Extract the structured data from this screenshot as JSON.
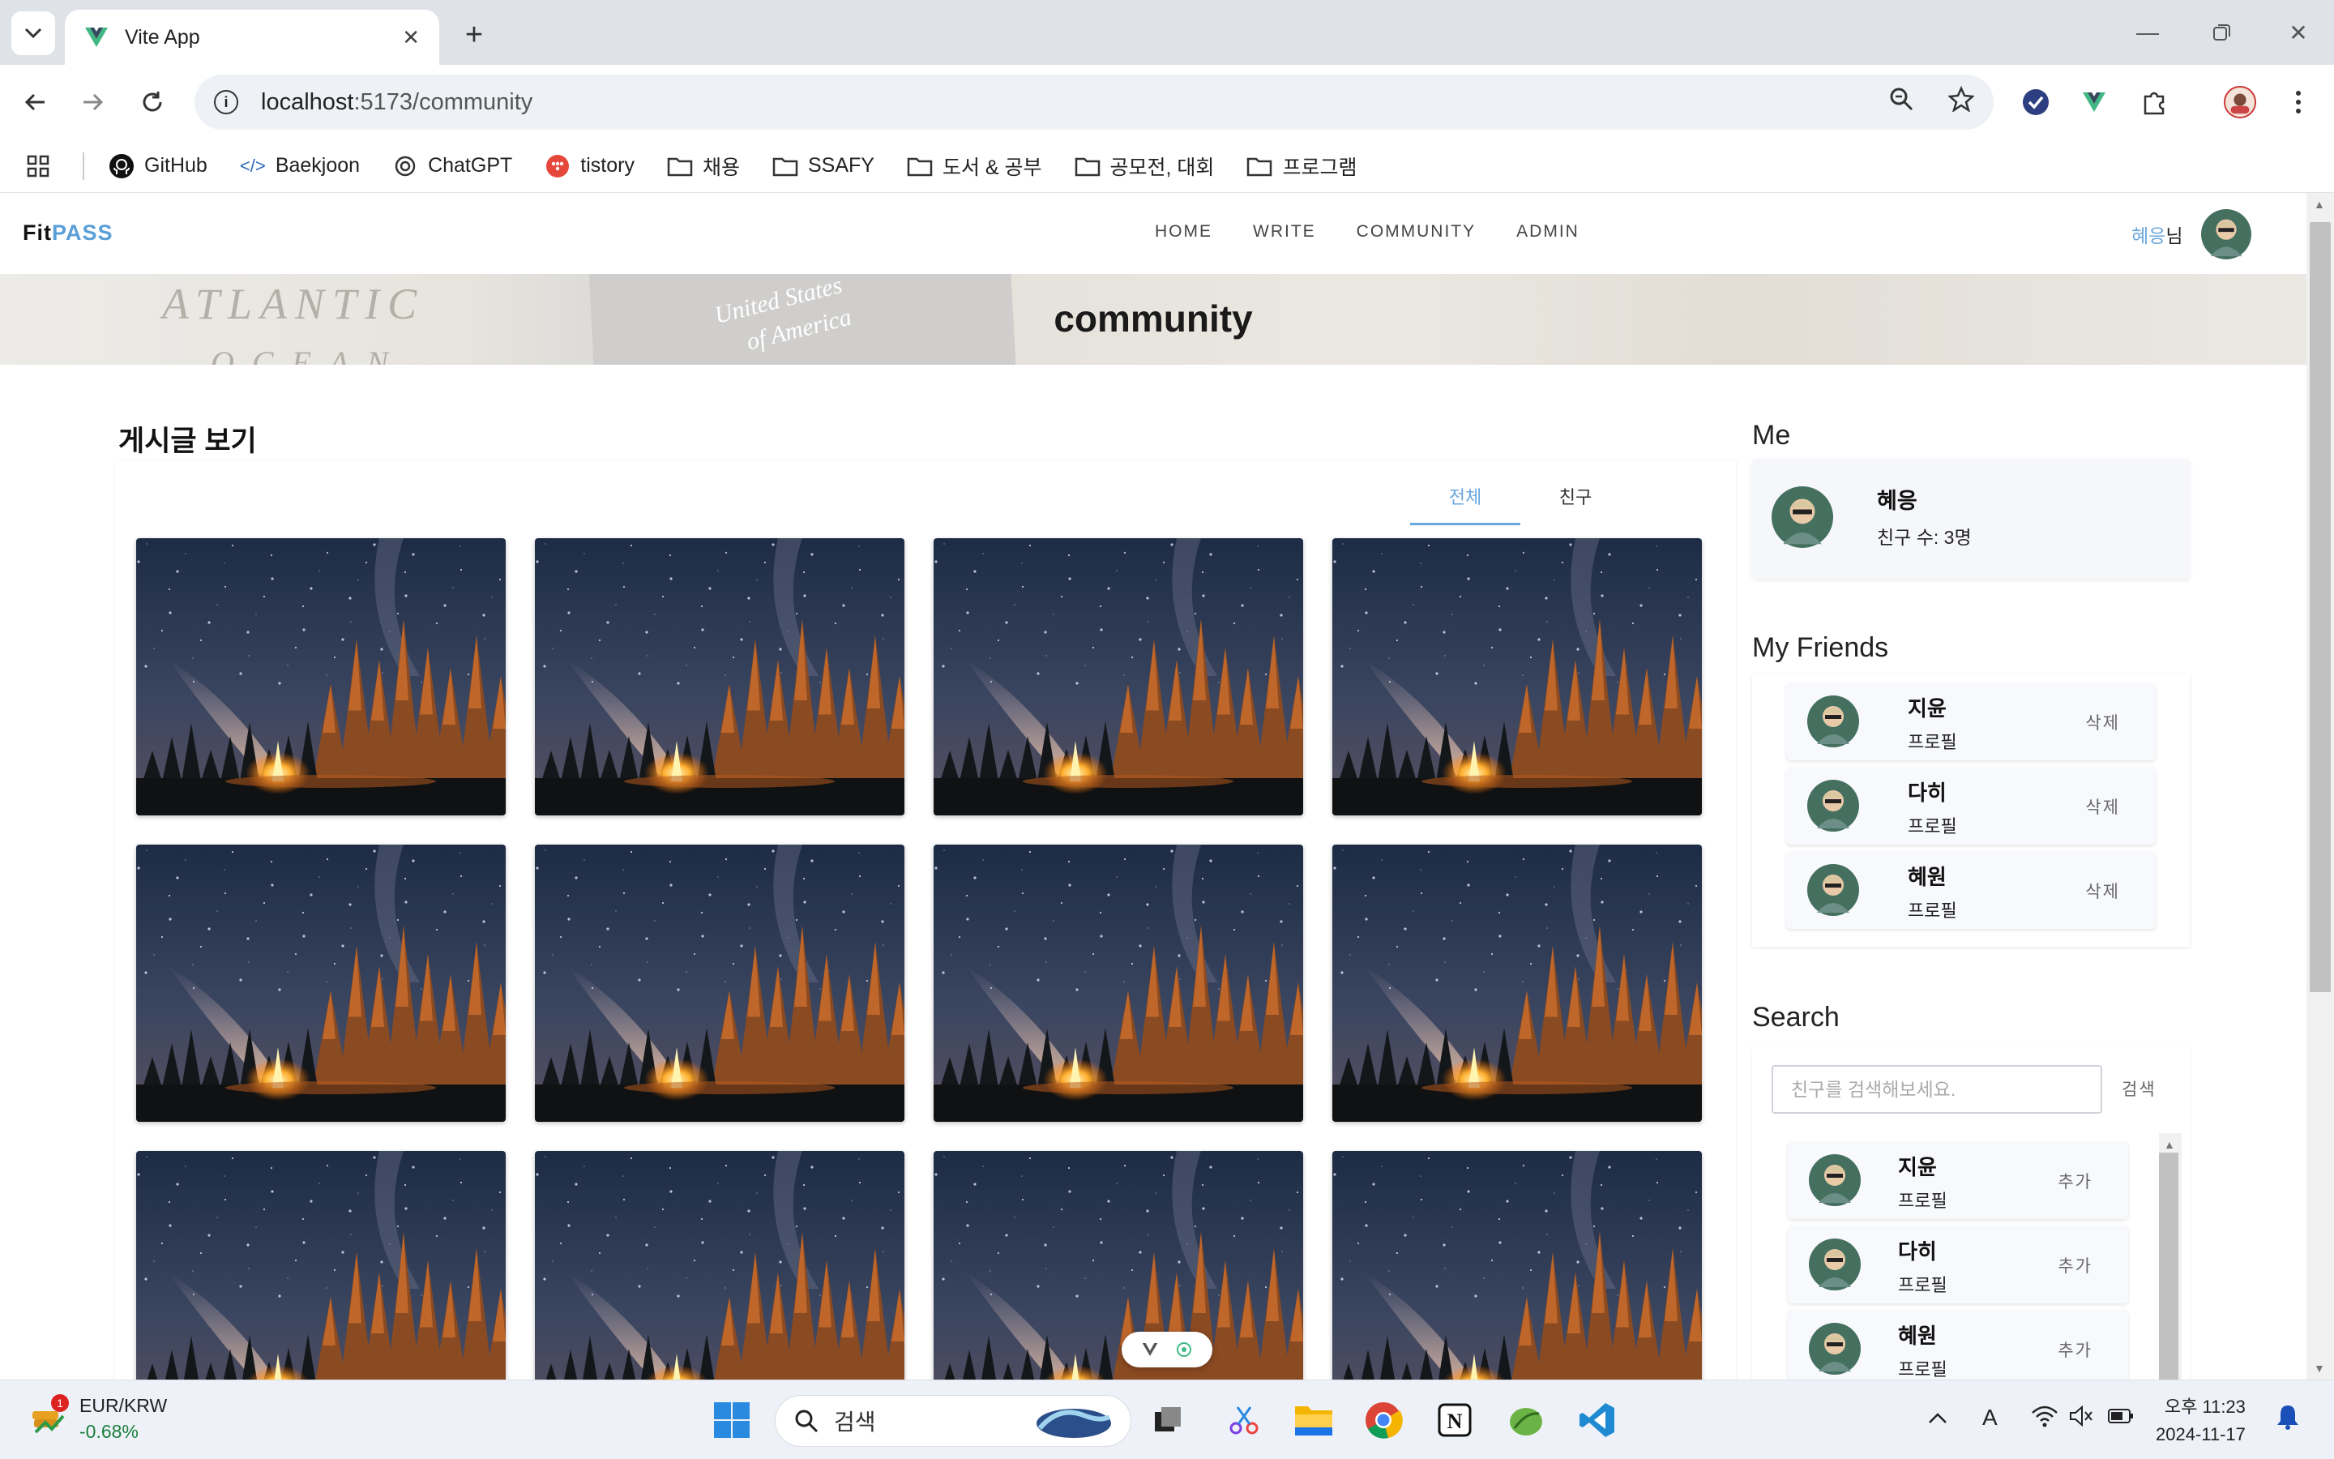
{
  "browser": {
    "tab_title": "Vite App",
    "url_host": "localhost",
    "url_rest": ":5173/community",
    "bookmarks": [
      "GitHub",
      "Baekjoon",
      "ChatGPT",
      "tistory",
      "채용",
      "SSAFY",
      "도서 & 공부",
      "공모전, 대회",
      "프로그램"
    ]
  },
  "app": {
    "logo_fit": "Fit",
    "logo_pass": "PASS",
    "nav": [
      "HOME",
      "WRITE",
      "COMMUNITY",
      "ADMIN"
    ],
    "user_name": "혜응",
    "user_suffix": "님"
  },
  "hero": {
    "title": "community",
    "deco_atlantic": "ATLANTIC",
    "deco_ocean": "OCEAN",
    "deco_us1": "United States",
    "deco_us2": "of America"
  },
  "posts": {
    "title": "게시글 보기",
    "tabs": [
      "전체",
      "친구"
    ],
    "active_tab": "전체",
    "image_count": 12
  },
  "me": {
    "heading": "Me",
    "name": "혜응",
    "friend_count": "친구 수: 3명"
  },
  "friends": {
    "heading": "My Friends",
    "items": [
      {
        "name": "지윤",
        "profile": "프로필",
        "action": "삭제"
      },
      {
        "name": "다히",
        "profile": "프로필",
        "action": "삭제"
      },
      {
        "name": "혜원",
        "profile": "프로필",
        "action": "삭제"
      }
    ]
  },
  "search": {
    "heading": "Search",
    "placeholder": "친구를 검색해보세요.",
    "button": "검색",
    "results": [
      {
        "name": "지윤",
        "profile": "프로필",
        "action": "추가"
      },
      {
        "name": "다히",
        "profile": "프로필",
        "action": "추가"
      },
      {
        "name": "혜원",
        "profile": "프로필",
        "action": "추가"
      }
    ]
  },
  "taskbar": {
    "ticker_pair": "EUR/KRW",
    "ticker_change": "-0.68%",
    "ticker_badge": "1",
    "search_label": "검색",
    "time": "오후 11:23",
    "date": "2024-11-17"
  },
  "colors": {
    "accent": "#6aa7dd",
    "ticker_green": "#1a7f3c"
  }
}
